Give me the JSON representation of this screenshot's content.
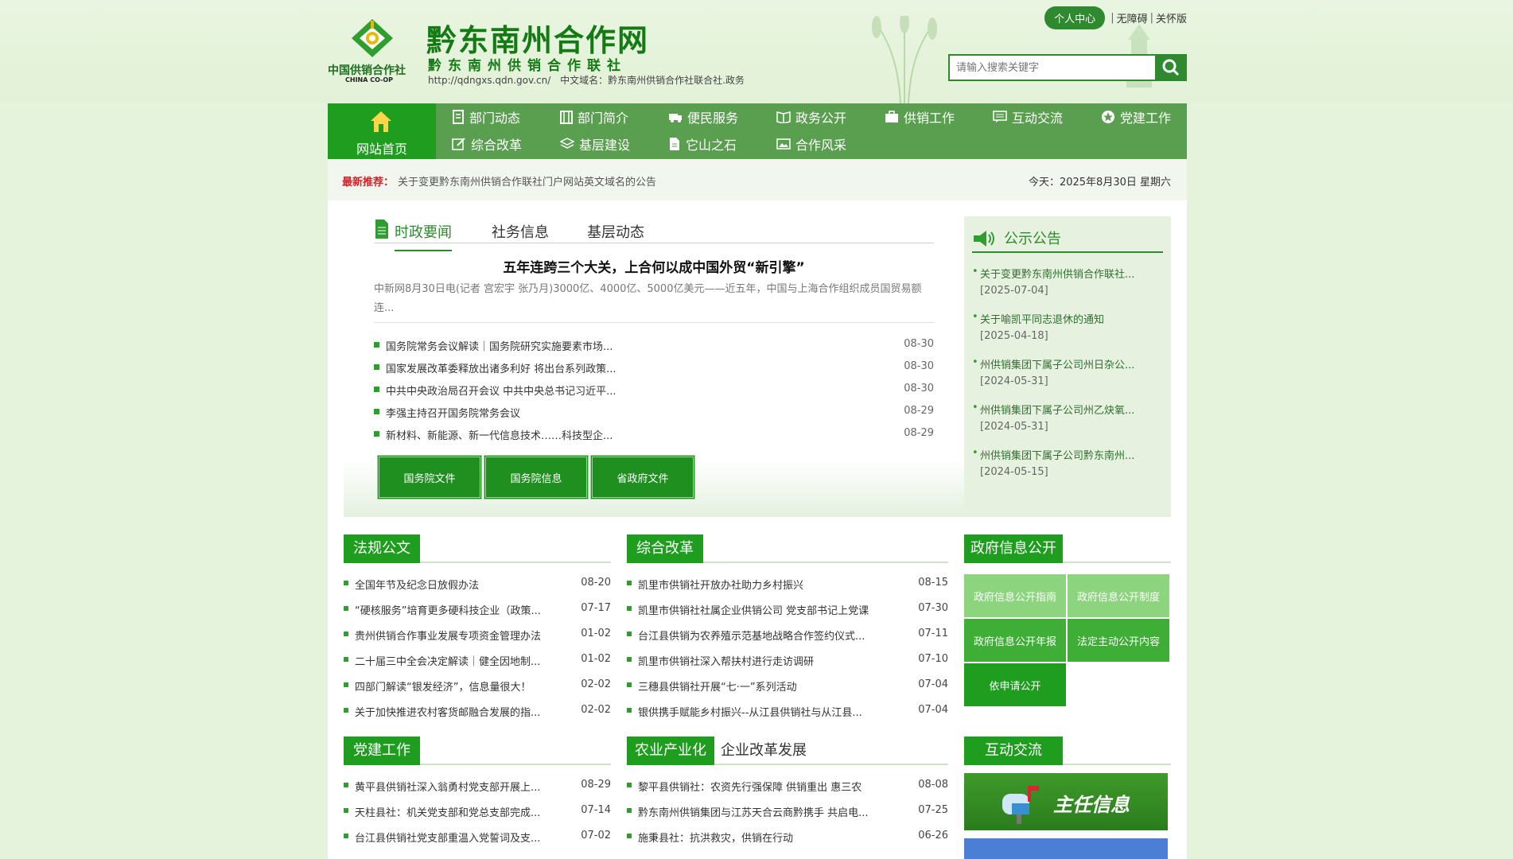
{
  "header": {
    "logo_cn": "中国供销合作社",
    "logo_en": "CHINA CO-OP",
    "site_title": "黔东南州合作网",
    "site_subtitle": "黔东南州供销合作联社",
    "site_url": "http://qdngxs.qdn.gov.cn/",
    "cn_domain": "中文域名：黔东南州供销合作社联合社.政务",
    "personal_center": "个人中心",
    "accessibility": "无障碍",
    "care_mode": "关怀版",
    "search_placeholder": "请输入搜索关键字"
  },
  "nav": {
    "home": "网站首页",
    "items": [
      {
        "label": "部门动态",
        "icon": "document-icon"
      },
      {
        "label": "部门简介",
        "icon": "building-icon"
      },
      {
        "label": "便民服务",
        "icon": "truck-icon"
      },
      {
        "label": "政务公开",
        "icon": "book-icon"
      },
      {
        "label": "供销工作",
        "icon": "briefcase-icon"
      },
      {
        "label": "互动交流",
        "icon": "chat-icon"
      },
      {
        "label": "党建工作",
        "icon": "star-icon"
      },
      {
        "label": "综合改革",
        "icon": "edit-icon"
      },
      {
        "label": "基层建设",
        "icon": "layers-icon"
      },
      {
        "label": "它山之石",
        "icon": "file-icon"
      },
      {
        "label": "合作风采",
        "icon": "image-icon"
      }
    ]
  },
  "recommend": {
    "label": "最新推荐：",
    "text": "关于变更黔东南州供销合作联社门户网站英文域名的公告",
    "date": "今天：2025年8月30日 星期六"
  },
  "news": {
    "tabs": [
      "时政要闻",
      "社务信息",
      "基层动态"
    ],
    "headline": "五年连跨三个大关，上合何以成中国外贸“新引擎”",
    "summary": "中新网8月30日电(记者 宫宏宇 张乃月)3000亿、4000亿、5000亿美元——近五年，中国与上海合作组织成员国贸易额连...",
    "items": [
      {
        "title": "国务院常务会议解读｜国务院研究实施要素市场...",
        "date": "08-30"
      },
      {
        "title": "国家发展改革委释放出诸多利好 将出台系列政策...",
        "date": "08-30"
      },
      {
        "title": "中共中央政治局召开会议 中共中央总书记习近平...",
        "date": "08-30"
      },
      {
        "title": "李强主持召开国务院常务会议",
        "date": "08-29"
      },
      {
        "title": "新材料、新能源、新一代信息技术……科技型企...",
        "date": "08-29"
      }
    ],
    "doc_buttons": [
      "国务院文件",
      "国务院信息",
      "省政府文件"
    ]
  },
  "notice": {
    "title": "公示公告",
    "items": [
      {
        "title": "关于变更黔东南州供销合作联社...",
        "date": "[2025-07-04]"
      },
      {
        "title": "关于喻凯平同志退休的通知",
        "date": "[2025-04-18]"
      },
      {
        "title": "州供销集团下属子公司州日杂公...",
        "date": "[2024-05-31]"
      },
      {
        "title": "州供销集团下属子公司州乙炔氧...",
        "date": "[2024-05-31]"
      },
      {
        "title": "州供销集团下属子公司黔东南州...",
        "date": "[2024-05-15]"
      }
    ]
  },
  "laws": {
    "title": "法规公文",
    "items": [
      {
        "title": "全国年节及纪念日放假办法",
        "date": "08-20"
      },
      {
        "title": "“硬核服务”培育更多硬科技企业（政策...",
        "date": "07-17"
      },
      {
        "title": "贵州供销合作事业发展专项资金管理办法",
        "date": "01-02"
      },
      {
        "title": "二十届三中全会决定解读｜健全因地制...",
        "date": "01-02"
      },
      {
        "title": "四部门解读“银发经济”，信息量很大！",
        "date": "02-02"
      },
      {
        "title": "关于加快推进农村客货邮融合发展的指...",
        "date": "02-02"
      }
    ]
  },
  "reform": {
    "title": "综合改革",
    "items": [
      {
        "title": "凯里市供销社开放办社助力乡村振兴",
        "date": "08-15"
      },
      {
        "title": "凯里市供销社社属企业供销公司 党支部书记上党课",
        "date": "07-30"
      },
      {
        "title": "台江县供销为农养殖示范基地战略合作签约仪式...",
        "date": "07-11"
      },
      {
        "title": "凯里市供销社深入帮扶村进行走访调研",
        "date": "07-10"
      },
      {
        "title": "三穗县供销社开展“七·一”系列活动",
        "date": "07-04"
      },
      {
        "title": "银供携手赋能乡村振兴--从江县供销社与从江县...",
        "date": "07-04"
      }
    ]
  },
  "gov_info": {
    "title": "政府信息公开",
    "buttons": [
      "政府信息公开指南",
      "政府信息公开制度",
      "政府信息公开年报",
      "法定主动公开内容",
      "依申请公开"
    ]
  },
  "party": {
    "title": "党建工作",
    "items": [
      {
        "title": "黄平县供销社深入翁勇村党支部开展上...",
        "date": "08-29"
      },
      {
        "title": "天柱县社：机关党支部和党总支部完成...",
        "date": "07-14"
      },
      {
        "title": "台江县供销社党支部重温入党誓词及支...",
        "date": "07-02"
      }
    ]
  },
  "agri": {
    "title": "农业产业化",
    "title2": "企业改革发展",
    "items": [
      {
        "title": "黎平县供销社：农资先行强保障 供销重出 惠三农",
        "date": "08-08"
      },
      {
        "title": "黔东南州供销集团与江苏天合云商黔携手 共启电...",
        "date": "07-25"
      },
      {
        "title": "施秉县社：抗洪救灾，供销在行动",
        "date": "06-26"
      }
    ]
  },
  "interact": {
    "title": "互动交流",
    "banner_text": "主任信息"
  }
}
